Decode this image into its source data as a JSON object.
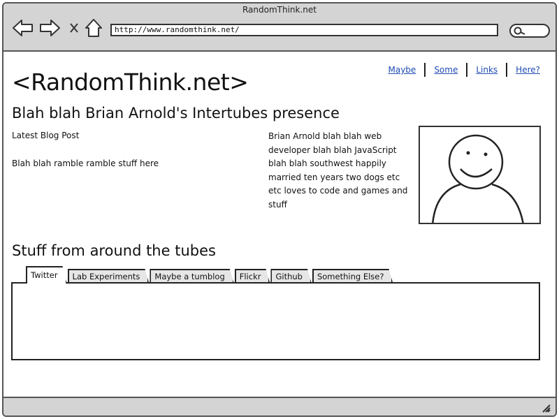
{
  "window": {
    "title": "RandomThink.net"
  },
  "browser": {
    "url": "http://www.randomthink.net/",
    "icons": [
      "back-arrow-icon",
      "forward-arrow-icon",
      "close-x-icon",
      "home-icon",
      "search-icon",
      "resize-grip-icon"
    ]
  },
  "site": {
    "title": "<RandomThink.net>",
    "nav": [
      {
        "label": "Maybe"
      },
      {
        "label": "Some"
      },
      {
        "label": "Links"
      },
      {
        "label": "Here?"
      }
    ],
    "subtitle": "Blah blah Brian Arnold's Intertubes presence",
    "blog": {
      "heading": "Latest Blog Post",
      "body": "Blah blah ramble ramble stuff here"
    },
    "bio": "Brian Arnold blah blah web developer blah blah JavaScript blah blah southwest happily married ten years two dogs etc etc loves to code and games and stuff",
    "section_title": "Stuff from around the tubes",
    "tabs": [
      {
        "label": "Twitter"
      },
      {
        "label": "Lab Experiments"
      },
      {
        "label": "Maybe a tumblog"
      },
      {
        "label": "Flickr"
      },
      {
        "label": "Github"
      },
      {
        "label": "Something Else?"
      }
    ],
    "active_tab": "Twitter"
  }
}
